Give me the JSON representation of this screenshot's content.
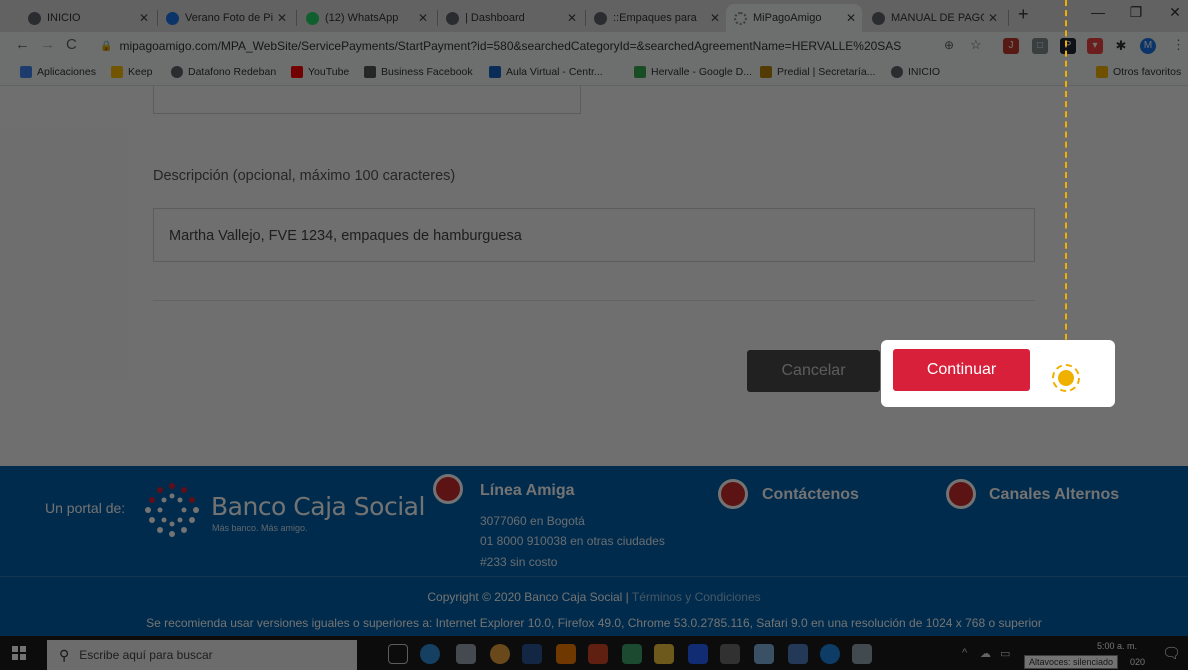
{
  "browser": {
    "tabs": [
      {
        "label": "INICIO",
        "icon": "globe-icon",
        "color": "#5f6368"
      },
      {
        "label": "Verano Foto de Pi",
        "icon": "photo-icon",
        "color": "#1a73e8"
      },
      {
        "label": "(12) WhatsApp",
        "icon": "whatsapp-icon",
        "color": "#25d366"
      },
      {
        "label": "| Dashboard",
        "icon": "globe-icon",
        "color": "#5f6368"
      },
      {
        "label": "::Empaques para",
        "icon": "globe-icon",
        "color": "#5f6368"
      },
      {
        "label": "MiPagoAmigo",
        "icon": "loading-icon",
        "color": "#888888"
      },
      {
        "label": "MANUAL DE PAGO",
        "icon": "globe-icon",
        "color": "#5f6368"
      }
    ],
    "new_tab": "+",
    "window_controls": {
      "minimize": "—",
      "restore": "❐",
      "close": "✕"
    },
    "url": "mipagoamigo.com/MPA_WebSite/ServicePayments/StartPayment?id=580&searchedCategoryId=&searchedAgreementName=HERVALLE%20SAS",
    "profile_initial": "M",
    "bookmarks": [
      {
        "label": "Aplicaciones",
        "color": "#4285f4"
      },
      {
        "label": "Keep",
        "color": "#fbbc04"
      },
      {
        "label": "Datafono Redeban",
        "color": "#5f6368"
      },
      {
        "label": "YouTube",
        "color": "#ff0000"
      },
      {
        "label": "Business Facebook",
        "color": "#555555"
      },
      {
        "label": "Aula Virtual - Centr...",
        "color": "#1565c0"
      },
      {
        "label": "Hervalle - Google D...",
        "color": "#34a853"
      },
      {
        "label": "Predial | Secretaría...",
        "color": "#b8860b"
      },
      {
        "label": "INICIO",
        "color": "#5f6368"
      }
    ],
    "other_bookmarks": "Otros favoritos"
  },
  "form": {
    "description_label": "Descripción (opcional, máximo 100 caracteres)",
    "description_value": "Martha Vallejo, FVE 1234, empaques de hamburguesa",
    "cancel_label": "Cancelar",
    "continue_label": "Continuar"
  },
  "footer": {
    "portal_label": "Un portal de:",
    "bank_name": "Banco Caja Social",
    "bank_slogan": "Más banco. Más amigo.",
    "linea_amiga": {
      "title": "Línea Amiga",
      "lines": [
        "3077060 en Bogotá",
        "01 8000 910038 en otras ciudades",
        "#233 sin costo"
      ]
    },
    "contactenos": "Contáctenos",
    "canales": "Canales Alternos",
    "copyright": "Copyright © 2020 Banco Caja Social |",
    "terms": "Términos y Condiciones",
    "recommendation": "Se recomienda usar versiones iguales o superiores a: Internet Explorer 10.0, Firefox 49.0, Chrome 53.0.2785.116, Safari 9.0 en una resolución de 1024 x 768 o superior"
  },
  "taskbar": {
    "search_placeholder": "Escribe aquí para buscar",
    "time": "5:00 a. m.",
    "tooltip": "Altavoces: silenciado",
    "year_fragment": "020",
    "notification_count": "2"
  },
  "colors": {
    "accent_red": "#d8203a",
    "footer_blue": "#0060a8",
    "guide_yellow": "#f0b000"
  }
}
